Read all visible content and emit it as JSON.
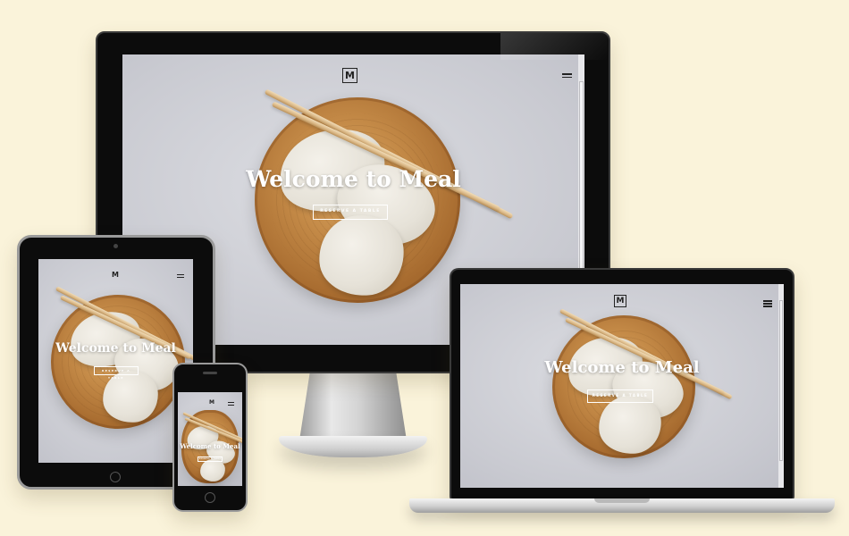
{
  "site": {
    "logo_letter": "M",
    "hero_title": "Welcome to Meal",
    "cta_label": "Reserve a table"
  },
  "devices": [
    "desktop-monitor",
    "laptop",
    "tablet",
    "phone"
  ],
  "colors": {
    "background": "#faf3da",
    "device_bezel": "#0d0d0d",
    "text_on_hero": "#ffffff"
  },
  "icons": {
    "menu": "hamburger-icon"
  }
}
